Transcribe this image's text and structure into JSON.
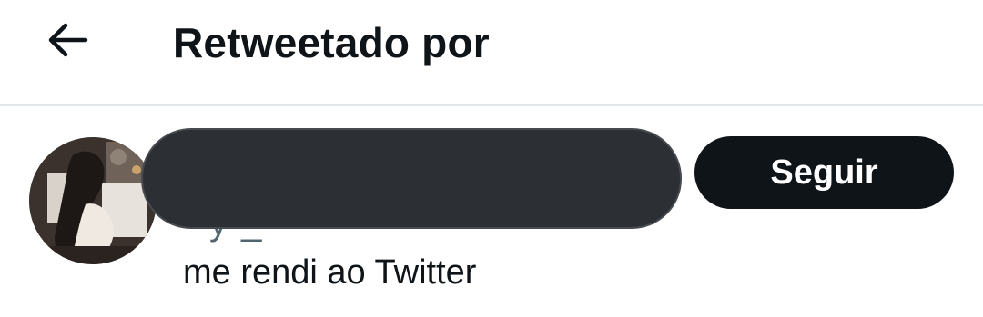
{
  "header": {
    "back_icon": "arrow-left-icon",
    "title": "Retweetado por"
  },
  "user": {
    "avatar_icon": "user-avatar-photo",
    "name_redacted": true,
    "handle_visible_fragment": "y _",
    "bio": "me rendi ao Twitter",
    "follow_label": "Seguir"
  },
  "colors": {
    "text_primary": "#0f1419",
    "text_secondary": "#536471",
    "divider": "#e1e6e9",
    "button_bg": "#0f1419",
    "button_text": "#ffffff",
    "redaction": "#2c3035"
  }
}
